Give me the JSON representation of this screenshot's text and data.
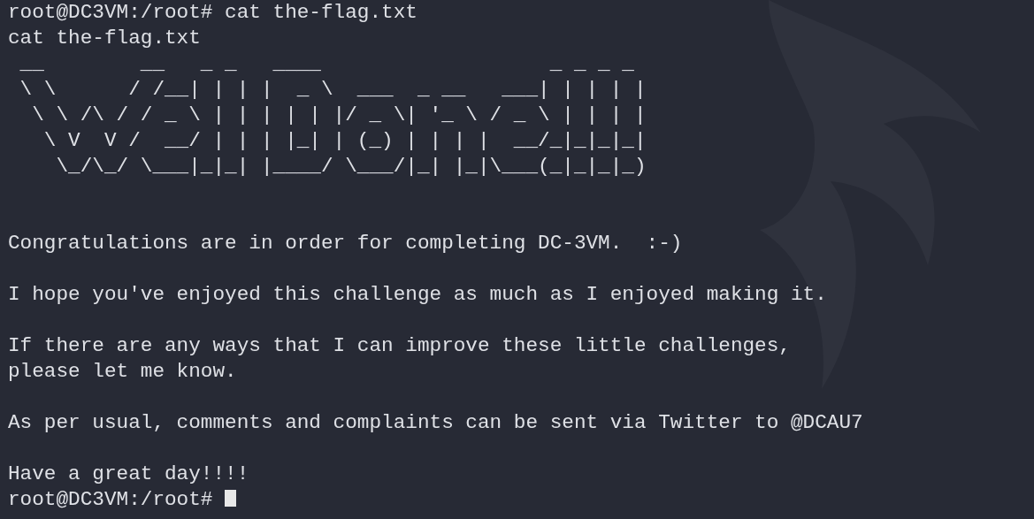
{
  "terminal": {
    "lines": [
      {
        "kind": "prompt",
        "prompt": "root@DC3VM:/root#",
        "command": "cat the-flag.txt"
      },
      {
        "kind": "output",
        "text": "cat the-flag.txt"
      },
      {
        "kind": "art",
        "rows": [
          " __        __   _ _   ____                   _ _ _ _ ",
          " \\ \\      / /__| | | |  _ \\  ___  _ __   ___| | | | |",
          "  \\ \\ /\\ / / _ \\ | | | | | |/ _ \\| '_ \\ / _ \\ | | | |",
          "   \\ V  V /  __/ | | | |_| | (_) | | | |  __/_|_|_|_|",
          "    \\_/\\_/ \\___|_|_| |____/ \\___/|_| |_|\\___(_|_|_|_)"
        ]
      },
      {
        "kind": "gap"
      },
      {
        "kind": "gap"
      },
      {
        "kind": "output",
        "text": "Congratulations are in order for completing DC-3VM.  :-)"
      },
      {
        "kind": "gap"
      },
      {
        "kind": "output",
        "text": "I hope you've enjoyed this challenge as much as I enjoyed making it."
      },
      {
        "kind": "gap"
      },
      {
        "kind": "output",
        "text": "If there are any ways that I can improve these little challenges,"
      },
      {
        "kind": "output",
        "text": "please let me know."
      },
      {
        "kind": "gap"
      },
      {
        "kind": "output",
        "text": "As per usual, comments and complaints can be sent via Twitter to @DCAU7"
      },
      {
        "kind": "gap"
      },
      {
        "kind": "output",
        "text": "Have a great day!!!!"
      },
      {
        "kind": "prompt",
        "prompt": "root@DC3VM:/root#",
        "cursor": true
      }
    ]
  }
}
